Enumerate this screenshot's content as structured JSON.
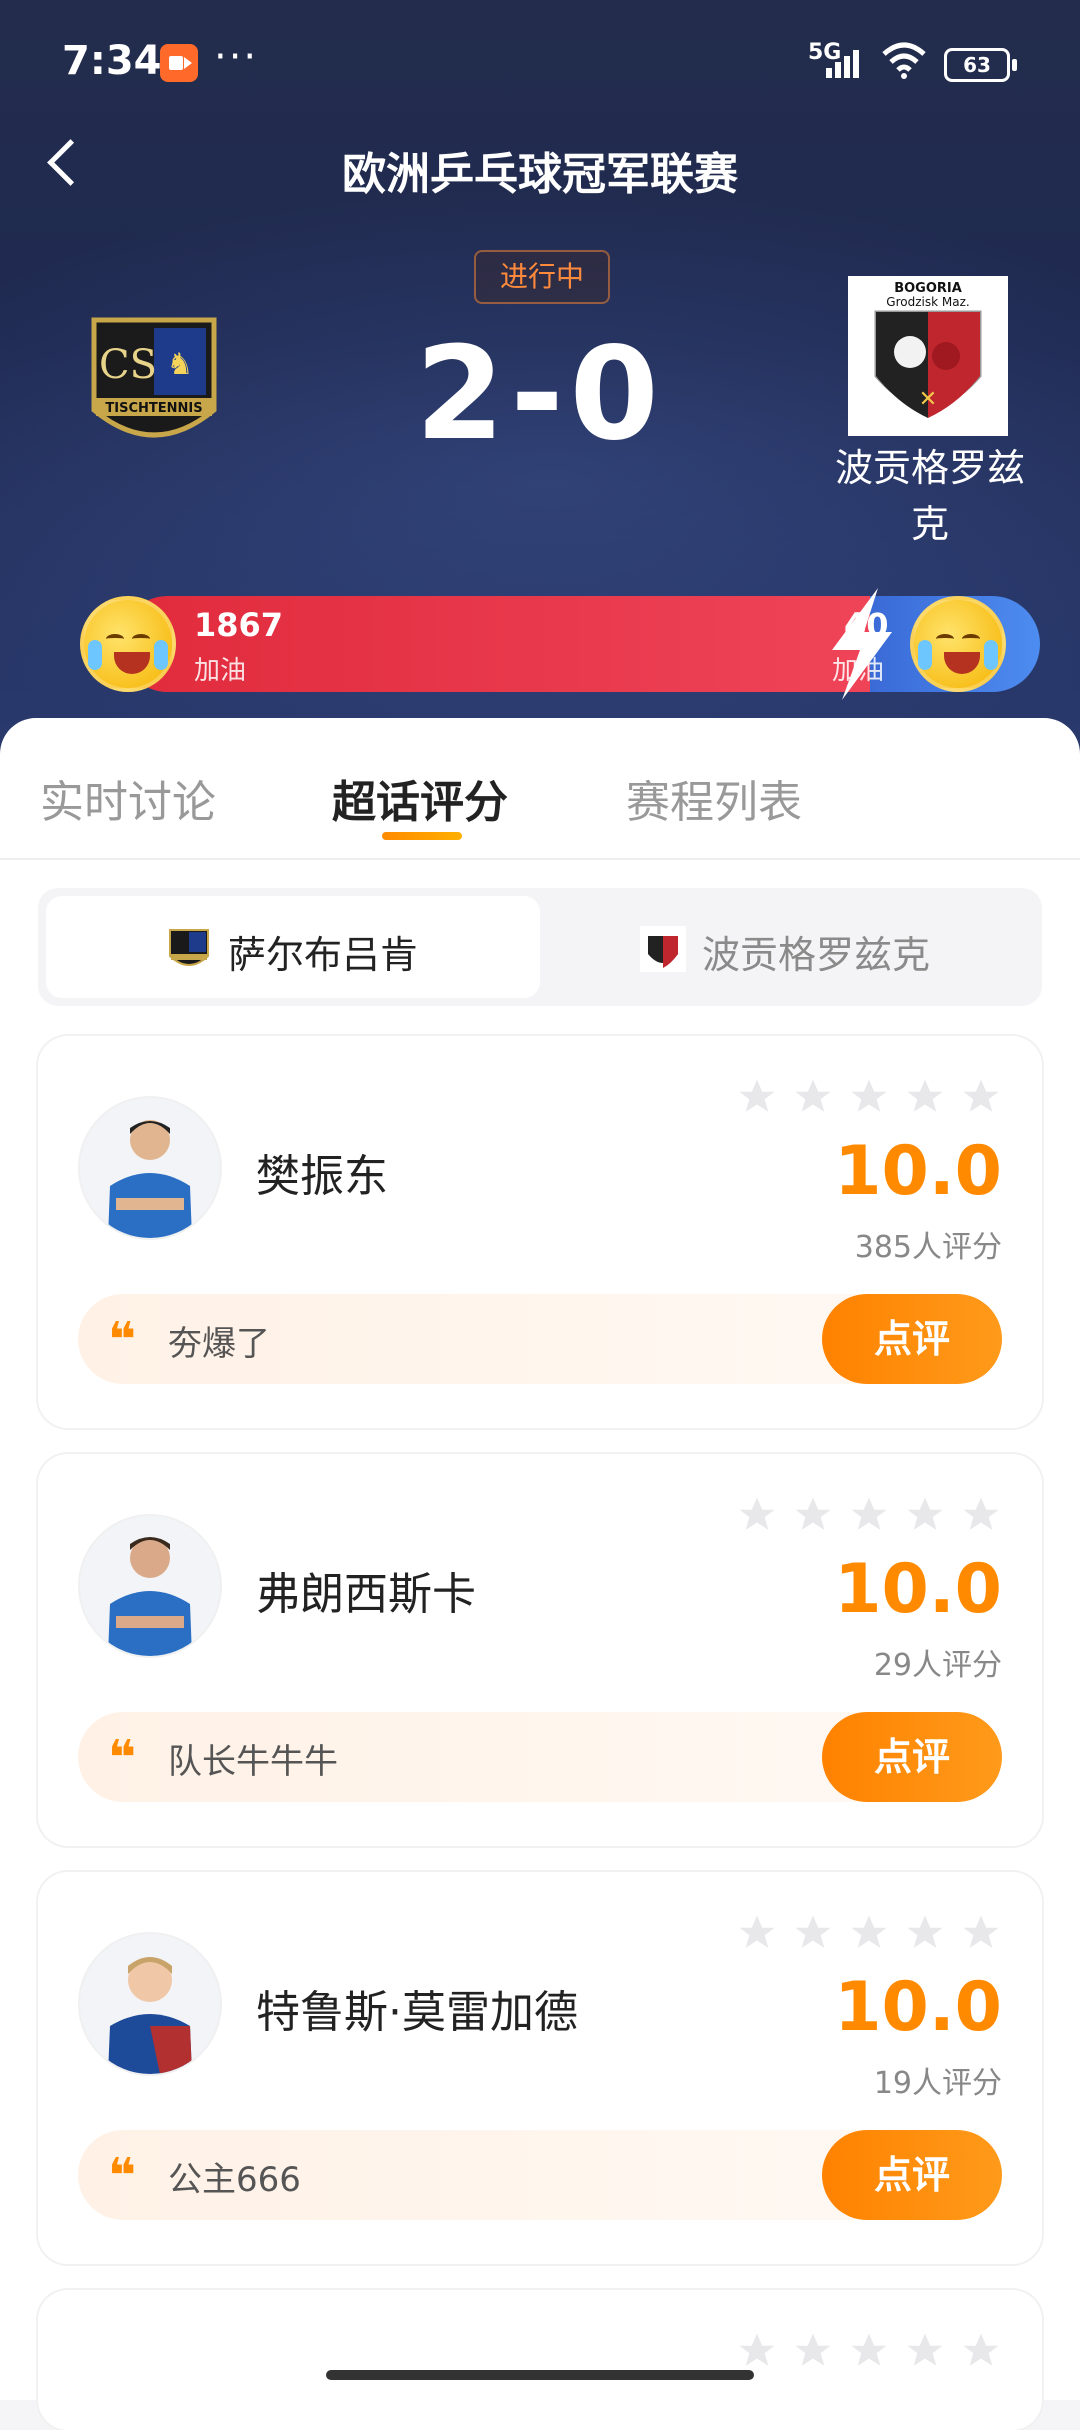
{
  "status_bar": {
    "time": "7:34",
    "signal": "5G",
    "battery": "63"
  },
  "header": {
    "title": "欧洲乒乓球冠军联赛",
    "live_status": "进行中",
    "score": "2-0"
  },
  "teams": {
    "away_name": "波贡格罗兹克"
  },
  "cheer": {
    "home_count": "1867",
    "home_label": "加油",
    "away_count": "40",
    "away_label": "加油"
  },
  "tabs": [
    {
      "label": "实时讨论"
    },
    {
      "label": "超话评分"
    },
    {
      "label": "赛程列表"
    }
  ],
  "team_switch": {
    "home": "萨尔布吕肯",
    "away": "波贡格罗兹克"
  },
  "players": [
    {
      "name": "樊振东",
      "rating": "10.0",
      "count": "385人评分",
      "comment": "夯爆了",
      "button": "点评",
      "stars": 5
    },
    {
      "name": "弗朗西斯卡",
      "rating": "10.0",
      "count": "29人评分",
      "comment": "队长牛牛牛",
      "button": "点评",
      "stars": 5
    },
    {
      "name": "特鲁斯·莫雷加德",
      "rating": "10.0",
      "count": "19人评分",
      "comment": "公主666",
      "button": "点评",
      "stars": 5
    }
  ],
  "colors": {
    "accent": "#ff8a00",
    "cheer_home": "#e02b3c",
    "cheer_away": "#3a6ad6",
    "header_bg": "#232c4c"
  }
}
